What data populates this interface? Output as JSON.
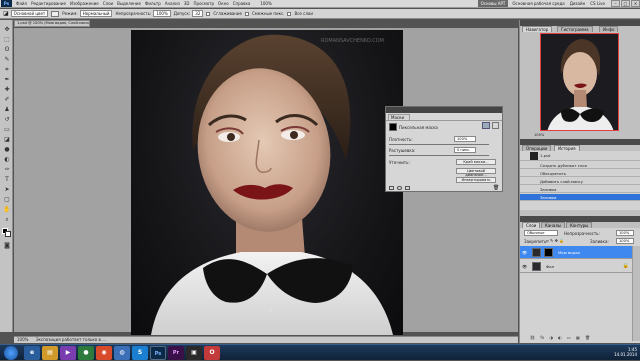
{
  "menubar": {
    "logo": "Ps",
    "items": [
      "Файл",
      "Редактирование",
      "Изображение",
      "Слои",
      "Выделение",
      "Фильтр",
      "Анализ",
      "3D",
      "Просмотр",
      "Окно",
      "Справка"
    ],
    "zoom": "100%",
    "workspace_button": "Основы АРТ",
    "workspace_link1": "Основная рабочая среда",
    "workspace_link2": "Дизайн",
    "cslive": "CS Live"
  },
  "options": {
    "preset": "Основной цвет",
    "mode_label": "Режим:",
    "mode_value": "Нормальный",
    "opacity_label": "Непрозрачность:",
    "opacity_value": "100%",
    "flow_label": "Допуск:",
    "flow_value": "32",
    "antialias_label": "Сглаживание",
    "contiguous_label": "Смежные пикс.",
    "allLayers_label": "Все слои"
  },
  "document": {
    "tab_title": "1.psd @ 100% (Мою водяя, Слой-маска/8) *",
    "watermark": "ROMANSAVCHENKO.COM"
  },
  "status": {
    "text": "100%",
    "info": "Экспозиция работает только в ..."
  },
  "masks_panel": {
    "tab": "Маски",
    "title": "Пиксельная маска",
    "density_label": "Плотность:",
    "density_value": "100%",
    "feather_label": "Растушевка:",
    "feather_value": "0 пикс.",
    "refine_label": "Уточнить:",
    "btn_edge": "Край маски...",
    "btn_color": "Цветовой диапазон...",
    "btn_invert": "Инвертировать"
  },
  "navigator": {
    "tab1": "Навигатор",
    "tab2": "Гистограмма",
    "tab3": "Инфо"
  },
  "history": {
    "tab1": "Операции",
    "tab2": "История",
    "snapshot": "1.psd",
    "items": [
      "Создать дубликат слоя",
      "Обесцветить",
      "Добавить слой-маску",
      "Заливка",
      "Заливка"
    ]
  },
  "layers": {
    "tab1": "Слои",
    "tab2": "Каналы",
    "tab3": "Контуры",
    "blend": "Обычные",
    "opacity_label": "Непрозрачность:",
    "opacity_value": "100%",
    "lock_label": "Закрепить:",
    "fill_label": "Заливка:",
    "fill_value": "100%",
    "items": [
      {
        "name": "Мою водяя"
      },
      {
        "name": "Фон"
      }
    ]
  },
  "taskbar": {
    "time": "1:45",
    "date": "14.01.2014"
  },
  "colors": {
    "selection_blue": "#3f88f0",
    "history_selected": "#2f73d9",
    "navigator_frame": "#e04040"
  }
}
